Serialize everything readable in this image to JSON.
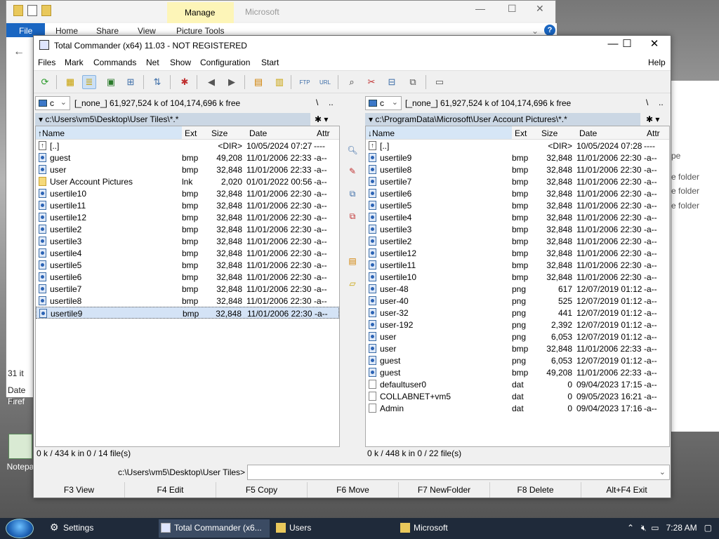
{
  "explorer": {
    "title": "Microsoft",
    "manage_tab": "Manage",
    "tabs": [
      "File",
      "Home",
      "Share",
      "View",
      "Picture Tools"
    ],
    "side_text": [
      "31 it",
      "Date cr",
      "Firef"
    ],
    "right_items": [
      "pe",
      "e folder",
      "e folder",
      "e folder"
    ]
  },
  "desktop_icon": {
    "label": "Notepa"
  },
  "tc": {
    "title": "Total Commander (x64) 11.03 - NOT REGISTERED",
    "menu": [
      "Files",
      "Mark",
      "Commands",
      "Net",
      "Show",
      "Configuration",
      "Start"
    ],
    "help": "Help",
    "left": {
      "drive": "c",
      "drive_info": "[_none_]  61,927,524 k of 104,174,696 k free",
      "path": "c:\\Users\\vm5\\Desktop\\User Tiles\\*.*",
      "headers": {
        "name": "Name",
        "ext": "Ext",
        "size": "Size",
        "date": "Date",
        "attr": "Attr"
      },
      "status": "0 k / 434 k in 0 / 14 file(s)",
      "files": [
        {
          "name": "[..]",
          "ext": "",
          "size": "<DIR>",
          "date": "10/05/2024 07:27",
          "attr": "----",
          "icon": "up"
        },
        {
          "name": "guest",
          "ext": "bmp",
          "size": "49,208",
          "date": "11/01/2006 22:33",
          "attr": "-a--",
          "icon": "bmp"
        },
        {
          "name": "user",
          "ext": "bmp",
          "size": "32,848",
          "date": "11/01/2006 22:33",
          "attr": "-a--",
          "icon": "bmp"
        },
        {
          "name": "User Account Pictures",
          "ext": "lnk",
          "size": "2,020",
          "date": "01/01/2022 00:56",
          "attr": "-a--",
          "icon": "lnk"
        },
        {
          "name": "usertile10",
          "ext": "bmp",
          "size": "32,848",
          "date": "11/01/2006 22:30",
          "attr": "-a--",
          "icon": "bmp"
        },
        {
          "name": "usertile11",
          "ext": "bmp",
          "size": "32,848",
          "date": "11/01/2006 22:30",
          "attr": "-a--",
          "icon": "bmp"
        },
        {
          "name": "usertile12",
          "ext": "bmp",
          "size": "32,848",
          "date": "11/01/2006 22:30",
          "attr": "-a--",
          "icon": "bmp"
        },
        {
          "name": "usertile2",
          "ext": "bmp",
          "size": "32,848",
          "date": "11/01/2006 22:30",
          "attr": "-a--",
          "icon": "bmp"
        },
        {
          "name": "usertile3",
          "ext": "bmp",
          "size": "32,848",
          "date": "11/01/2006 22:30",
          "attr": "-a--",
          "icon": "bmp"
        },
        {
          "name": "usertile4",
          "ext": "bmp",
          "size": "32,848",
          "date": "11/01/2006 22:30",
          "attr": "-a--",
          "icon": "bmp"
        },
        {
          "name": "usertile5",
          "ext": "bmp",
          "size": "32,848",
          "date": "11/01/2006 22:30",
          "attr": "-a--",
          "icon": "bmp"
        },
        {
          "name": "usertile6",
          "ext": "bmp",
          "size": "32,848",
          "date": "11/01/2006 22:30",
          "attr": "-a--",
          "icon": "bmp"
        },
        {
          "name": "usertile7",
          "ext": "bmp",
          "size": "32,848",
          "date": "11/01/2006 22:30",
          "attr": "-a--",
          "icon": "bmp"
        },
        {
          "name": "usertile8",
          "ext": "bmp",
          "size": "32,848",
          "date": "11/01/2006 22:30",
          "attr": "-a--",
          "icon": "bmp"
        },
        {
          "name": "usertile9",
          "ext": "bmp",
          "size": "32,848",
          "date": "11/01/2006 22:30",
          "attr": "-a--",
          "icon": "bmp",
          "selected": true
        }
      ]
    },
    "right": {
      "drive": "c",
      "drive_info": "[_none_]  61,927,524 k of 104,174,696 k free",
      "path": "c:\\ProgramData\\Microsoft\\User Account Pictures\\*.*",
      "headers": {
        "name": "Name",
        "ext": "Ext",
        "size": "Size",
        "date": "Date",
        "attr": "Attr"
      },
      "status": "0 k / 448 k in 0 / 22 file(s)",
      "files": [
        {
          "name": "[..]",
          "ext": "",
          "size": "<DIR>",
          "date": "10/05/2024 07:28",
          "attr": "----",
          "icon": "up"
        },
        {
          "name": "usertile9",
          "ext": "bmp",
          "size": "32,848",
          "date": "11/01/2006 22:30",
          "attr": "-a--",
          "icon": "bmp"
        },
        {
          "name": "usertile8",
          "ext": "bmp",
          "size": "32,848",
          "date": "11/01/2006 22:30",
          "attr": "-a--",
          "icon": "bmp"
        },
        {
          "name": "usertile7",
          "ext": "bmp",
          "size": "32,848",
          "date": "11/01/2006 22:30",
          "attr": "-a--",
          "icon": "bmp"
        },
        {
          "name": "usertile6",
          "ext": "bmp",
          "size": "32,848",
          "date": "11/01/2006 22:30",
          "attr": "-a--",
          "icon": "bmp"
        },
        {
          "name": "usertile5",
          "ext": "bmp",
          "size": "32,848",
          "date": "11/01/2006 22:30",
          "attr": "-a--",
          "icon": "bmp"
        },
        {
          "name": "usertile4",
          "ext": "bmp",
          "size": "32,848",
          "date": "11/01/2006 22:30",
          "attr": "-a--",
          "icon": "bmp"
        },
        {
          "name": "usertile3",
          "ext": "bmp",
          "size": "32,848",
          "date": "11/01/2006 22:30",
          "attr": "-a--",
          "icon": "bmp"
        },
        {
          "name": "usertile2",
          "ext": "bmp",
          "size": "32,848",
          "date": "11/01/2006 22:30",
          "attr": "-a--",
          "icon": "bmp"
        },
        {
          "name": "usertile12",
          "ext": "bmp",
          "size": "32,848",
          "date": "11/01/2006 22:30",
          "attr": "-a--",
          "icon": "bmp"
        },
        {
          "name": "usertile11",
          "ext": "bmp",
          "size": "32,848",
          "date": "11/01/2006 22:30",
          "attr": "-a--",
          "icon": "bmp"
        },
        {
          "name": "usertile10",
          "ext": "bmp",
          "size": "32,848",
          "date": "11/01/2006 22:30",
          "attr": "-a--",
          "icon": "bmp"
        },
        {
          "name": "user-48",
          "ext": "png",
          "size": "617",
          "date": "12/07/2019 01:12",
          "attr": "-a--",
          "icon": "png"
        },
        {
          "name": "user-40",
          "ext": "png",
          "size": "525",
          "date": "12/07/2019 01:12",
          "attr": "-a--",
          "icon": "png"
        },
        {
          "name": "user-32",
          "ext": "png",
          "size": "441",
          "date": "12/07/2019 01:12",
          "attr": "-a--",
          "icon": "png"
        },
        {
          "name": "user-192",
          "ext": "png",
          "size": "2,392",
          "date": "12/07/2019 01:12",
          "attr": "-a--",
          "icon": "png"
        },
        {
          "name": "user",
          "ext": "png",
          "size": "6,053",
          "date": "12/07/2019 01:12",
          "attr": "-a--",
          "icon": "png"
        },
        {
          "name": "user",
          "ext": "bmp",
          "size": "32,848",
          "date": "11/01/2006 22:33",
          "attr": "-a--",
          "icon": "bmp"
        },
        {
          "name": "guest",
          "ext": "png",
          "size": "6,053",
          "date": "12/07/2019 01:12",
          "attr": "-a--",
          "icon": "png"
        },
        {
          "name": "guest",
          "ext": "bmp",
          "size": "49,208",
          "date": "11/01/2006 22:33",
          "attr": "-a--",
          "icon": "bmp"
        },
        {
          "name": "defaultuser0",
          "ext": "dat",
          "size": "0",
          "date": "09/04/2023 17:15",
          "attr": "-a--",
          "icon": "dat"
        },
        {
          "name": "COLLABNET+vm5",
          "ext": "dat",
          "size": "0",
          "date": "09/05/2023 16:21",
          "attr": "-a--",
          "icon": "dat"
        },
        {
          "name": "Admin",
          "ext": "dat",
          "size": "0",
          "date": "09/04/2023 17:16",
          "attr": "-a--",
          "icon": "dat"
        }
      ]
    },
    "cmd_path": "c:\\Users\\vm5\\Desktop\\User Tiles>",
    "fkeys": [
      "F3 View",
      "F4 Edit",
      "F5 Copy",
      "F6 Move",
      "F7 NewFolder",
      "F8 Delete",
      "Alt+F4 Exit"
    ]
  },
  "taskbar": {
    "items": [
      "Settings",
      "Total Commander (x6...",
      "Users",
      "Microsoft"
    ],
    "time": "7:28 AM"
  }
}
